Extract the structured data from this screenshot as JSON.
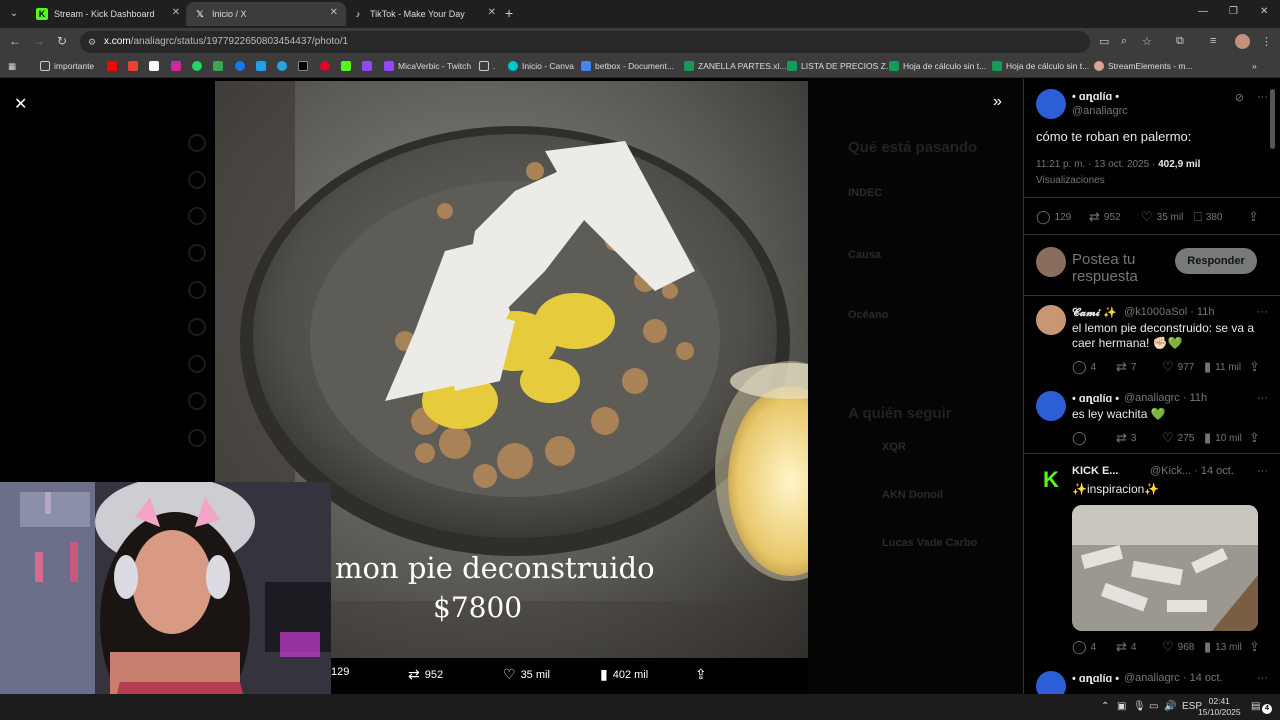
{
  "browser": {
    "tabs": [
      {
        "title": "Stream - Kick Dashboard",
        "icon": "K",
        "icon_color": "#53fc18"
      },
      {
        "title": "Inicio / X",
        "icon": "𝕏",
        "icon_color": "#ffffff"
      },
      {
        "title": "TikTok - Make Your Day",
        "icon": "♪",
        "icon_color": "#ffffff"
      }
    ],
    "url_host": "x.com",
    "url_path": "/analiagrc/status/1977922650803454437/photo/1",
    "bookmarks": {
      "importante": "importante",
      "micaverbic": "MicaVerbic - Twitch",
      "dot": ".",
      "canva": "Inicio - Canva",
      "betbox": "betbox - Document...",
      "zanella": "ZANELLA PARTES.xl...",
      "precios": "LISTA DE PRECIOS Z...",
      "hoja1": "Hoja de cálculo sin t...",
      "hoja2": "Hoja de cálculo sin t...",
      "streamelements": "StreamElements - m..."
    }
  },
  "photo": {
    "caption_line1": "mon pie deconstruido",
    "caption_line2": "$7800",
    "actions": {
      "replies": "129",
      "reposts": "952",
      "likes": "35 mil",
      "views": "402 mil"
    }
  },
  "background_page": {
    "trending_title": "Qué está pasando",
    "trend1": "INDEC",
    "trend2": "Causa",
    "trend3": "Océano",
    "follow_title": "A quién seguir",
    "follow1": "XQR",
    "follow2": "AKN Donoil",
    "follow3": "Lucas Vade Carbo"
  },
  "main_tweet": {
    "name": "• ɑղɑlíɑ •",
    "handle": "@analiagrc",
    "text": "cómo te roban en palermo:",
    "time": "11:21 p. m. · 13 oct. 2025 · ",
    "views_count": "402,9 mil",
    "views_label": "Visualizaciones",
    "replies": "129",
    "reposts": "952",
    "likes": "35 mil",
    "bookmarks": "380"
  },
  "reply_box": {
    "placeholder": "Postea tu respuesta",
    "button": "Responder"
  },
  "replies": [
    {
      "name": "𝓒𝓪𝓶𝓲 ✨",
      "handle": "@k1000aSol · 11h",
      "text": "el lemon pie deconstruido: se va a caer hermana! ✊🏻💚",
      "replies": "4",
      "reposts": "7",
      "likes": "977",
      "views": "11 mil"
    },
    {
      "name": "• ɑղɑlíɑ •",
      "handle": "@analiagrc · 11h",
      "text": "es ley wachita 💚",
      "replies": "",
      "reposts": "3",
      "likes": "275",
      "views": "10 mil"
    },
    {
      "name": "KICK E...",
      "handle": "@Kick... · 14 oct.",
      "text": "✨inspiracion✨",
      "replies": "4",
      "reposts": "4",
      "likes": "968",
      "views": "13 mil"
    },
    {
      "name": "• ɑղɑlíɑ •",
      "handle": "@analiagrc · 14 oct.",
      "text": "",
      "replies": "",
      "reposts": "",
      "likes": "",
      "views": ""
    }
  ],
  "taskbar": {
    "lang": "ESP",
    "time": "02:41",
    "date": "15/10/2025",
    "notifications": "4"
  }
}
